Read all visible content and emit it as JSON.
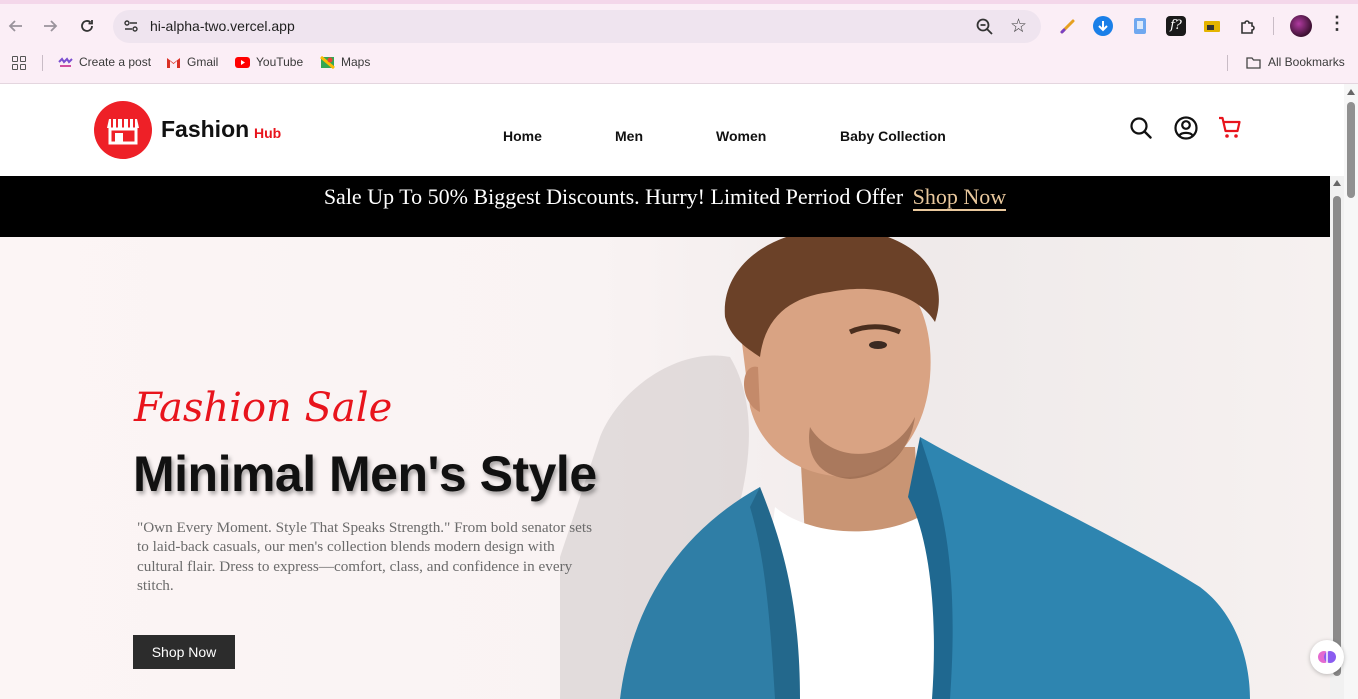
{
  "browser": {
    "url": "hi-alpha-two.vercel.app",
    "bookmarks": [
      {
        "label": "Create a post",
        "icon": "create-post-icon"
      },
      {
        "label": "Gmail",
        "icon": "gmail-icon"
      },
      {
        "label": "YouTube",
        "icon": "youtube-icon"
      },
      {
        "label": "Maps",
        "icon": "maps-icon"
      }
    ],
    "all_bookmarks": "All Bookmarks"
  },
  "header": {
    "brand": "Fashion",
    "brand_sub": "Hub",
    "nav": [
      "Home",
      "Men",
      "Women",
      "Baby Collection"
    ],
    "icons": [
      "search-icon",
      "account-icon",
      "cart-icon"
    ]
  },
  "promo": {
    "text": "Sale Up To 50% Biggest Discounts. Hurry! Limited Perriod Offer",
    "link": "Shop Now"
  },
  "hero": {
    "kicker": "Fashion Sale",
    "title": "Minimal Men's Style",
    "description": "\"Own Every Moment. Style That Speaks Strength.\" From bold senator sets to laid-back casuals, our men's collection blends modern design with cultural flair. Dress to express—comfort, class, and confidence in every stitch.",
    "button": "Shop Now"
  },
  "colors": {
    "accent": "#ee2027",
    "promo_bg": "#000000",
    "promo_link": "#e9c89d",
    "button_bg": "#2c2c2c"
  }
}
